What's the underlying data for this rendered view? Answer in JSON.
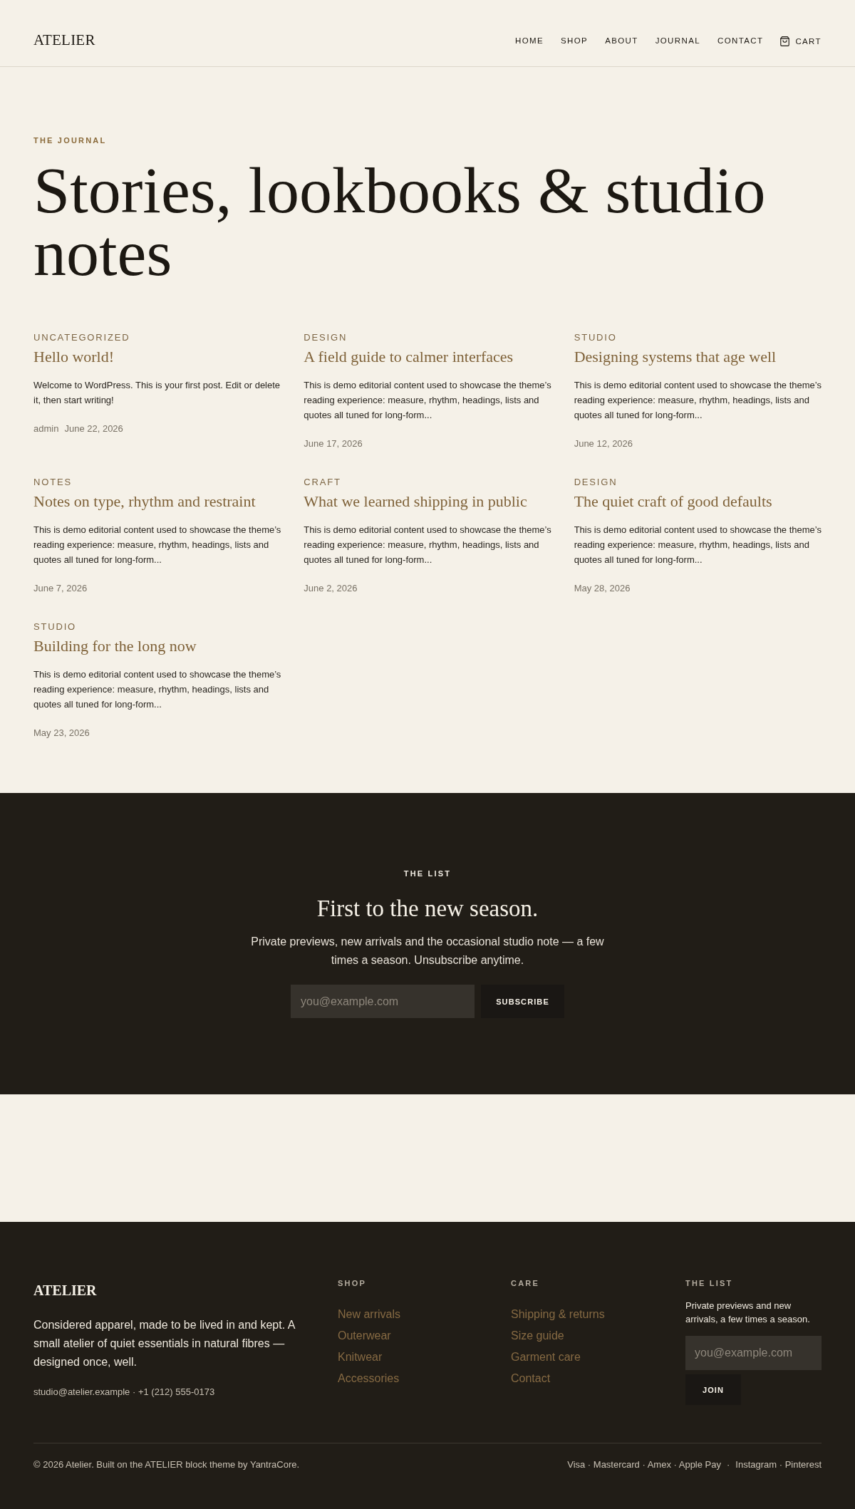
{
  "header": {
    "logo": "ATELIER",
    "nav": [
      "HOME",
      "SHOP",
      "ABOUT",
      "JOURNAL",
      "CONTACT"
    ],
    "cart": "CART"
  },
  "hero": {
    "eyebrow": "THE JOURNAL",
    "title": "Stories, lookbooks & studio notes"
  },
  "posts": [
    {
      "category": "UNCATEGORIZED",
      "title": "Hello world!",
      "excerpt": "Welcome to WordPress. This is your first post. Edit or delete it, then start writing!",
      "author": "admin",
      "date": "June 22, 2026"
    },
    {
      "category": "DESIGN",
      "title": "A field guide to calmer interfaces",
      "excerpt": "This is demo editorial content used to showcase the theme’s reading experience: measure, rhythm, headings, lists and quotes all tuned for long-form...",
      "date": "June 17, 2026"
    },
    {
      "category": "STUDIO",
      "title": "Designing systems that age well",
      "excerpt": "This is demo editorial content used to showcase the theme’s reading experience: measure, rhythm, headings, lists and quotes all tuned for long-form...",
      "date": "June 12, 2026"
    },
    {
      "category": "NOTES",
      "title": "Notes on type, rhythm and restraint",
      "excerpt": "This is demo editorial content used to showcase the theme’s reading experience: measure, rhythm, headings, lists and quotes all tuned for long-form...",
      "date": "June 7, 2026"
    },
    {
      "category": "CRAFT",
      "title": "What we learned shipping in public",
      "excerpt": "This is demo editorial content used to showcase the theme’s reading experience: measure, rhythm, headings, lists and quotes all tuned for long-form...",
      "date": "June 2, 2026"
    },
    {
      "category": "DESIGN",
      "title": "The quiet craft of good defaults",
      "excerpt": "This is demo editorial content used to showcase the theme’s reading experience: measure, rhythm, headings, lists and quotes all tuned for long-form...",
      "date": "May 28, 2026"
    },
    {
      "category": "STUDIO",
      "title": "Building for the long now",
      "excerpt": "This is demo editorial content used to showcase the theme’s reading experience: measure, rhythm, headings, lists and quotes all tuned for long-form...",
      "date": "May 23, 2026"
    }
  ],
  "newsletter": {
    "eyebrow": "THE LIST",
    "title": "First to the new season.",
    "text": "Private previews, new arrivals and the occasional studio note — a few times a season. Unsubscribe anytime.",
    "placeholder": "you@example.com",
    "button": "SUBSCRIBE"
  },
  "footer": {
    "logo": "ATELIER",
    "tagline": "Considered apparel, made to be lived in and kept. A small atelier of quiet essentials in natural fibres — designed once, well.",
    "contact": "studio@atelier.example · +1 (212) 555-0173",
    "columns": [
      {
        "heading": "SHOP",
        "links": [
          "New arrivals",
          "Outerwear",
          "Knitwear",
          "Accessories"
        ]
      },
      {
        "heading": "CARE",
        "links": [
          "Shipping & returns",
          "Size guide",
          "Garment care",
          "Contact"
        ]
      }
    ],
    "list": {
      "heading": "THE LIST",
      "text": "Private previews and new arrivals, a few times a season.",
      "placeholder": "you@example.com",
      "button": "JOIN"
    },
    "copyright": "© 2026 Atelier. Built on the ATELIER block theme by YantraCore.",
    "payments": "Visa · Mastercard · Amex · Apple Pay",
    "separator": "·",
    "social": "Instagram · Pinterest"
  }
}
